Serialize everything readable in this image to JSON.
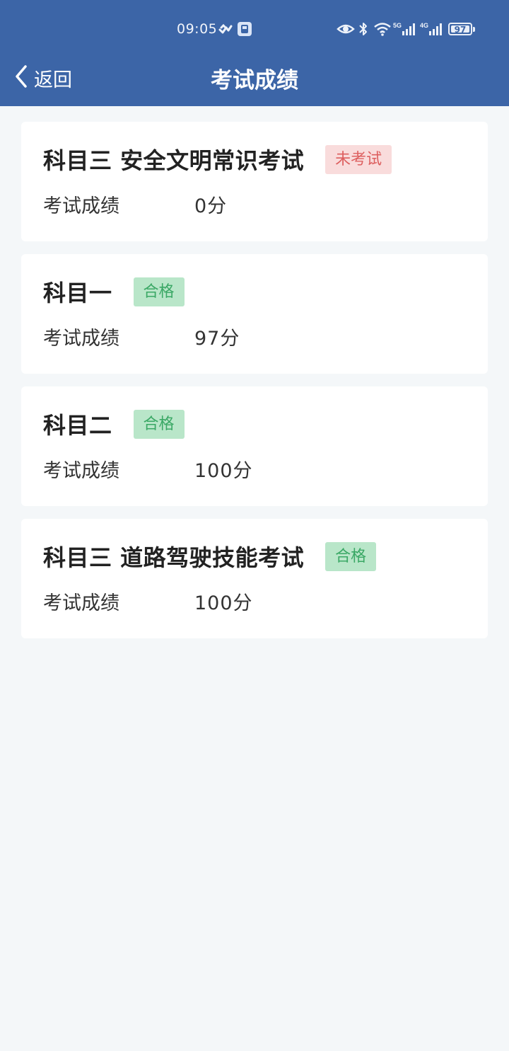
{
  "status_bar": {
    "time": "09:05",
    "battery": "97",
    "signal1_label": "5G",
    "signal2_label": "4G"
  },
  "nav": {
    "back_label": "返回",
    "title": "考试成绩"
  },
  "score_label": "考试成绩",
  "colors": {
    "header": "#3c65a7",
    "pass_bg": "#b9e6c9",
    "pass_text": "#3aa865",
    "fail_bg": "#f9dcdc",
    "fail_text": "#dd5f5f"
  },
  "exams": [
    {
      "name": "科目三 安全文明常识考试",
      "status": "未考试",
      "status_type": "fail",
      "score": "0分"
    },
    {
      "name": "科目一",
      "status": "合格",
      "status_type": "pass",
      "score": "97分"
    },
    {
      "name": "科目二",
      "status": "合格",
      "status_type": "pass",
      "score": "100分"
    },
    {
      "name": "科目三 道路驾驶技能考试",
      "status": "合格",
      "status_type": "pass",
      "score": "100分"
    }
  ]
}
